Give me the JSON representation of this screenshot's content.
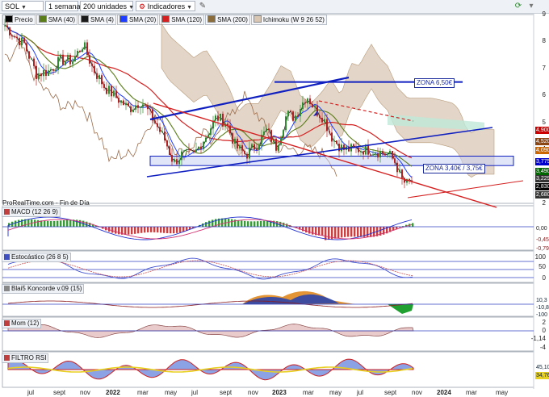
{
  "toolbar": {
    "symbol": "SOL",
    "timeframe": "1 semana",
    "units": "200 unidades",
    "indicators": "Indicadores"
  },
  "legend": [
    "Precio",
    "SMA (40)",
    "SMA (4)",
    "SMA (20)",
    "SMA (120)",
    "SMA (200)",
    "Ichimoku (W 9 26 52)"
  ],
  "source_note": "ProRealTime.com - Fin de Día",
  "panels": {
    "macd": "MACD (12 26 9)",
    "stoch": "Estocástico (26 8 5)",
    "konc": "Blai5 Koncorde v.09 (15)",
    "mom": "Mom (12)",
    "rsi": "FILTRO RSI"
  },
  "zones": {
    "upper": "ZONA 6,50€",
    "lower": "ZONA 3,40€ / 3,75€"
  },
  "price_axis": [
    "9",
    "8",
    "7",
    "6",
    "5",
    "4",
    "3",
    "2"
  ],
  "price_badges": [
    {
      "text": "4,900",
      "color": "#cc0000"
    },
    {
      "text": "4,520",
      "color": "#8b4513"
    },
    {
      "text": "4,090",
      "color": "#cc6600"
    },
    {
      "text": "3,775",
      "color": "#0000cc"
    },
    {
      "text": "3,490",
      "color": "#006600"
    },
    {
      "text": "3,229",
      "color": "#333333"
    },
    {
      "text": "2,830",
      "color": "#000000"
    },
    {
      "text": "2,680",
      "color": "#333333"
    }
  ],
  "macd_axis": [
    "0,00",
    "-0,45",
    "-0,79"
  ],
  "stoch_axis": [
    "100",
    "50",
    "0"
  ],
  "konc_axis": [
    "10,3",
    "-10,8",
    "-100"
  ],
  "mom_axis": [
    "2",
    "0",
    "-1,14",
    "-4"
  ],
  "rsi_axis": [
    "45,10",
    "34,76"
  ],
  "x_labels": [
    {
      "text": "jul",
      "bold": false
    },
    {
      "text": "sept",
      "bold": false
    },
    {
      "text": "nov",
      "bold": false
    },
    {
      "text": "2022",
      "bold": true
    },
    {
      "text": "mar",
      "bold": false
    },
    {
      "text": "may",
      "bold": false
    },
    {
      "text": "jul",
      "bold": false
    },
    {
      "text": "sept",
      "bold": false
    },
    {
      "text": "nov",
      "bold": false
    },
    {
      "text": "2023",
      "bold": true
    },
    {
      "text": "mar",
      "bold": false
    },
    {
      "text": "may",
      "bold": false
    },
    {
      "text": "jul",
      "bold": false
    },
    {
      "text": "sept",
      "bold": false
    },
    {
      "text": "nov",
      "bold": false
    },
    {
      "text": "2024",
      "bold": true
    },
    {
      "text": "mar",
      "bold": false
    },
    {
      "text": "may",
      "bold": false
    }
  ],
  "colors": {
    "up": "#2e8b2e",
    "down": "#b22222",
    "sma4": "#1a1a1a",
    "sma20": "#1e3cff",
    "sma40": "#5a7d1a",
    "sma120": "#d42020",
    "sma200": "#8a6d3b",
    "cloud": "#d9c7b4",
    "cloud_green": "#bfe8d8",
    "trend": "#1020c0"
  },
  "chart_data": {
    "type": "candlestick",
    "title": "SOL",
    "timeframe": "1 semana",
    "x": [
      "2021-07",
      "2021-09",
      "2021-11",
      "2022-01",
      "2022-03",
      "2022-05",
      "2022-07",
      "2022-09",
      "2022-11",
      "2023-01",
      "2023-03",
      "2023-05",
      "2023-07",
      "2023-09",
      "2023-11"
    ],
    "close": [
      8.6,
      7.7,
      7.8,
      6.0,
      5.4,
      4.4,
      3.6,
      4.0,
      4.7,
      5.0,
      6.1,
      5.5,
      4.4,
      3.8,
      2.83
    ],
    "last": 2.83,
    "ylim": [
      2,
      9
    ],
    "levels": [
      6.5,
      3.75,
      3.4
    ],
    "indicators": [
      "MACD (12 26 9)",
      "Estocástico (26 8 5)",
      "Blai5 Koncorde v.09 (15)",
      "Mom (12)",
      "FILTRO RSI"
    ]
  }
}
